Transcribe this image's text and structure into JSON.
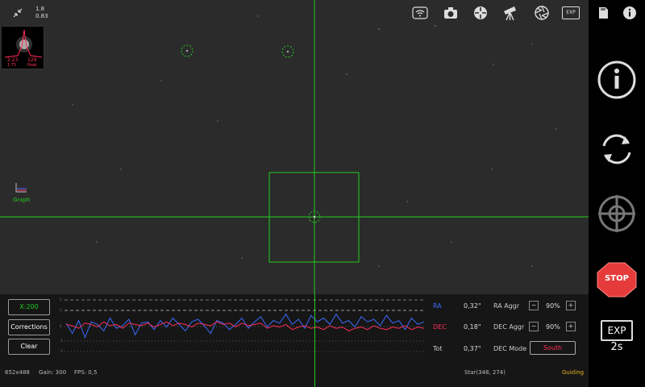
{
  "top_left": {
    "scale_top": "1.8",
    "scale_bottom": "0.83"
  },
  "star_profile": {
    "left_top": "2.23",
    "left_bottom": "1.75",
    "right_top": "129",
    "right_bottom": "Peak"
  },
  "graph_label": "Graph",
  "toolbar_icons": [
    "wifi-icon",
    "camera-icon",
    "target-icon",
    "telescope-icon",
    "aperture-icon",
    "exposure-icon",
    "sd-card-icon",
    "info-icon"
  ],
  "toolbar_exp_label": "EXP",
  "controls": {
    "scale_label": "X:200",
    "corrections_label": "Corrections",
    "clear_label": "Clear"
  },
  "graph_axis": {
    "t1": "2",
    "t2": "1",
    "t3": "0",
    "t4": "-1",
    "t5": "-2"
  },
  "stats": {
    "ra_label": "RA",
    "ra_value": "0,32\"",
    "dec_label": "DEC",
    "dec_value": "0,18\"",
    "tot_label": "Tot",
    "tot_value": "0,37\""
  },
  "aggr": {
    "ra_label": "RA Aggr",
    "ra_value": "90%",
    "dec_label": "DEC Aggr",
    "dec_value": "90%",
    "minus": "−",
    "plus": "+",
    "mode_label": "DEC Mode",
    "mode_value": "South"
  },
  "status_bar": {
    "resolution": "652x488",
    "gain": "Gain: 300",
    "fps": "FPS: 0,5",
    "star": "Star(348, 274)",
    "state": "Guiding"
  },
  "sidebar": {
    "stop_label": "STOP",
    "exp_label": "EXP",
    "exp_value": "2s"
  },
  "colors": {
    "ra": "#3b6cff",
    "dec": "#ff2d55",
    "green": "#22cc22",
    "guiding": "#e6b422",
    "stop": "#e63b3b"
  },
  "chart_data": {
    "type": "line",
    "series": [
      {
        "name": "RA",
        "values": [
          0.2,
          -0.6,
          0.4,
          -0.9,
          0.3,
          0.1,
          -0.4,
          0.6,
          -0.2,
          0.0,
          0.5,
          -0.7,
          0.2,
          0.3,
          -0.3,
          0.4,
          -0.1,
          0.6,
          0.1,
          -0.4,
          0.3,
          0.5,
          0.0,
          -0.6,
          0.4,
          0.2,
          -0.3,
          0.1,
          0.6,
          -0.2,
          0.3,
          0.7,
          -0.1,
          0.4,
          0.2,
          0.9,
          0.1,
          0.5,
          -0.2,
          0.8,
          0.3,
          0.6,
          0.1,
          0.9,
          0.2,
          0.4,
          -0.1,
          0.7,
          0.3,
          0.5,
          0.0,
          0.8,
          0.2,
          0.4,
          -0.3,
          0.6,
          0.1,
          0.3
        ]
      },
      {
        "name": "DEC",
        "values": [
          0.1,
          0.0,
          -0.2,
          0.2,
          0.1,
          -0.1,
          0.3,
          0.0,
          0.1,
          -0.2,
          0.2,
          0.1,
          0.0,
          0.2,
          -0.1,
          0.1,
          0.3,
          0.0,
          0.2,
          0.1,
          -0.1,
          0.2,
          0.1,
          0.0,
          0.3,
          0.1,
          0.2,
          -0.1,
          0.2,
          0.0,
          0.1,
          0.2,
          -0.2,
          0.0,
          -0.1,
          0.1,
          -0.3,
          -0.1,
          0.0,
          -0.2,
          -0.1,
          -0.3,
          0.0,
          -0.2,
          -0.1,
          -0.4,
          -0.2,
          -0.1,
          -0.3,
          0.0,
          -0.2,
          -0.3,
          -0.1,
          -0.2,
          0.0,
          -0.3,
          -0.1,
          -0.2
        ]
      }
    ],
    "ylim": [
      -2,
      2
    ]
  }
}
